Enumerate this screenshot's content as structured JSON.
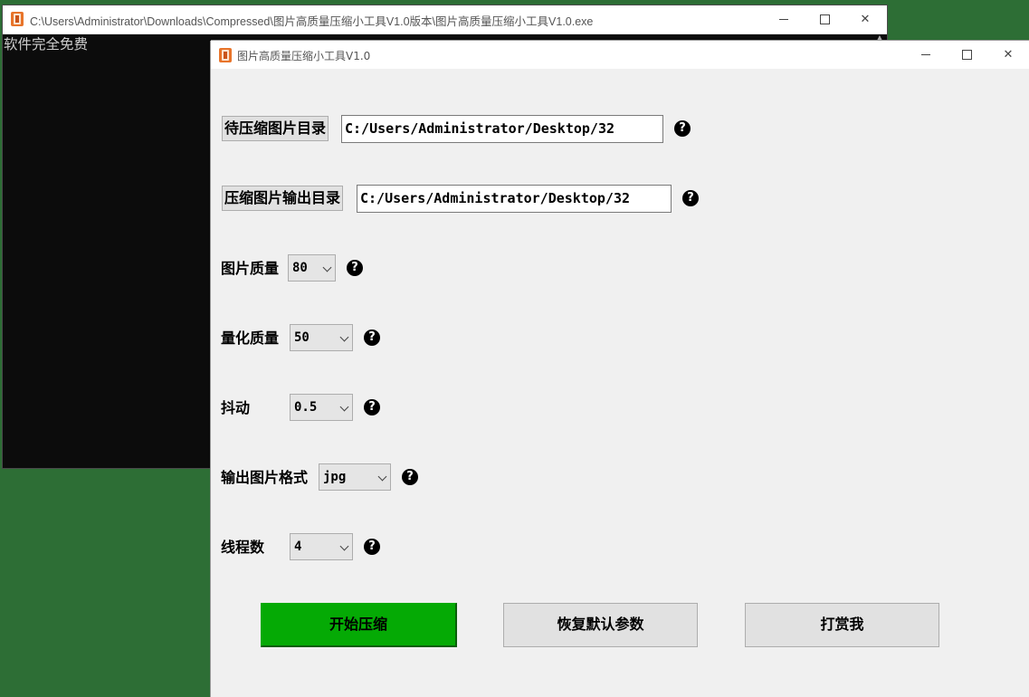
{
  "console_window": {
    "title": "C:\\Users\\Administrator\\Downloads\\Compressed\\图片高质量压缩小工具V1.0版本\\图片高质量压缩小工具V1.0.exe",
    "output_line": "软件完全免费"
  },
  "app_window": {
    "title": "图片高质量压缩小工具V1.0"
  },
  "form": {
    "input_dir": {
      "button_label": "待压缩图片目录",
      "value": "C:/Users/Administrator/Desktop/32"
    },
    "output_dir": {
      "button_label": "压缩图片输出目录",
      "value": "C:/Users/Administrator/Desktop/32"
    },
    "image_quality": {
      "label": "图片质量",
      "value": "80"
    },
    "quant_quality": {
      "label": "量化质量",
      "value": "50"
    },
    "dither": {
      "label": "抖动",
      "value": "0.5"
    },
    "output_format": {
      "label": "输出图片格式",
      "value": "jpg"
    },
    "threads": {
      "label": "线程数",
      "value": "4"
    },
    "help_glyph": "?"
  },
  "actions": {
    "start": "开始压缩",
    "restore": "恢复默认参数",
    "donate": "打赏我"
  },
  "colors": {
    "desktop": "#2d6e35",
    "console_bg": "#0c0c0c",
    "primary_button": "#05aa05"
  },
  "icons": [
    "app-icon",
    "minimize-icon",
    "maximize-icon",
    "close-icon",
    "help-icon",
    "chevron-down-icon"
  ]
}
